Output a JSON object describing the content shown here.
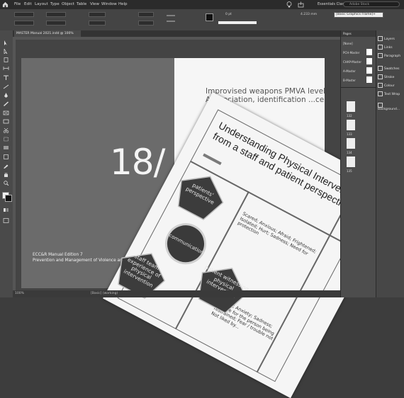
{
  "app": {
    "menu": [
      "File",
      "Edit",
      "Layout",
      "Type",
      "Object",
      "Table",
      "View",
      "Window",
      "Help"
    ],
    "workspace": "Essentials Classic",
    "search_placeholder": "Adobe Stock"
  },
  "controlbar": {
    "stroke_weight": "0 pt",
    "dimension": "4.233 mm",
    "style": "[Basic Graphics Frame]+"
  },
  "document": {
    "tab_title": "MASTER Manual 2021.indd @ 100%"
  },
  "canvas": {
    "big_number": "18/",
    "right_title": "Improvised weapons PMVA level Appreciation, identification ...ce",
    "footer_line1": "ECC&R Manual Edition 7",
    "footer_line2": "Prevention and Management of Violence and A..."
  },
  "pages_panel": {
    "header": "Pages",
    "items": [
      "[None]",
      "PCH-Master",
      "CHAP-Master",
      "A-Master",
      "B-Master"
    ],
    "page_numbers": [
      "132",
      "133",
      "134",
      "135"
    ]
  },
  "side_panel": {
    "items": [
      "Layers",
      "Links",
      "Paragraph",
      "Swatches",
      "Stroke",
      "Colour",
      "Text Wrap",
      "Background..."
    ]
  },
  "status": {
    "zoom": "100%",
    "style": "[Basic] (working)"
  },
  "photo": {
    "title": "Understanding Physical Intervention from a staff and patient perspective",
    "text_col1": "Scared; Anxious; Afraid; Frightened; Isolated; Hurt; Sadness; Need for protection",
    "text_col2": "Scared; Anxiety; Sadness; Trouble for the person being restrained; Fear / trouble not Not liked by...",
    "shape_top": "patients' perspective",
    "shape_center": "communication",
    "shape_right": "patient witnessing physical intervention",
    "shape_left": "staff team experience of physical intervention"
  }
}
